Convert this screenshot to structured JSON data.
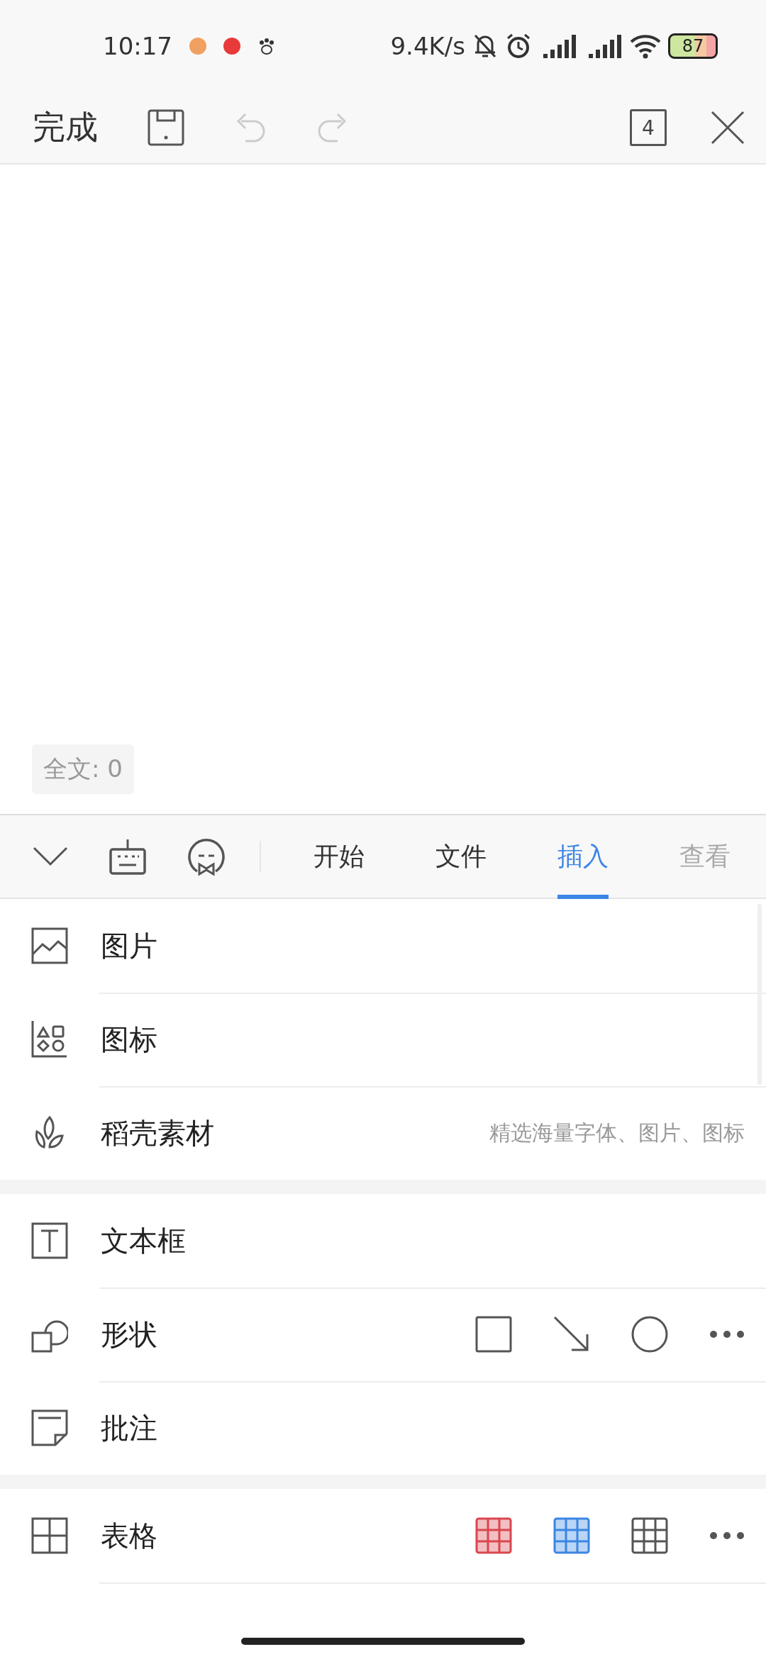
{
  "status_bar": {
    "time": "10:17",
    "net_speed": "9.4K/s",
    "battery": "87"
  },
  "toolbar": {
    "done": "完成",
    "page_count": "4"
  },
  "word_count": "全文: 0",
  "tabs": [
    {
      "label": "开始",
      "selected": false
    },
    {
      "label": "文件",
      "selected": false
    },
    {
      "label": "插入",
      "selected": true
    },
    {
      "label": "查看",
      "selected": false
    }
  ],
  "groups": [
    {
      "items": [
        {
          "kind": "plain",
          "label": "图片"
        },
        {
          "kind": "plain",
          "label": "图标"
        },
        {
          "kind": "hint",
          "label": "稻壳素材",
          "hint": "精选海量字体、图片、图标"
        }
      ]
    },
    {
      "items": [
        {
          "kind": "plain",
          "label": "文本框"
        },
        {
          "kind": "shapes",
          "label": "形状"
        },
        {
          "kind": "plain",
          "label": "批注"
        }
      ]
    },
    {
      "items": [
        {
          "kind": "tables",
          "label": "表格",
          "table_styles": [
            {
              "color": "#d9474f"
            },
            {
              "color": "#3a86e3"
            },
            {
              "color": "#555555"
            }
          ]
        }
      ]
    }
  ]
}
